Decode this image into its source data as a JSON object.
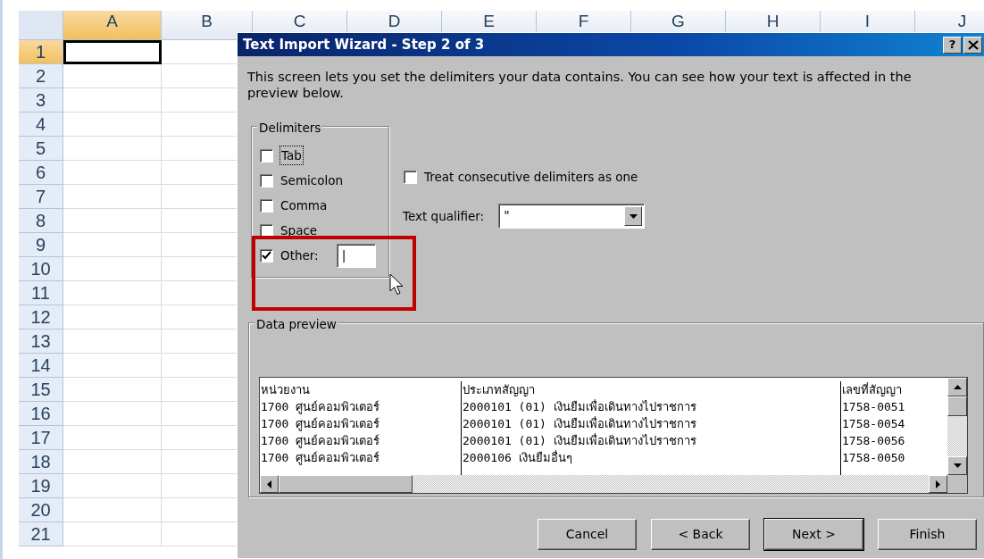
{
  "sheet": {
    "columns": [
      {
        "label": "A",
        "selected": true
      },
      {
        "label": "B",
        "selected": false
      },
      {
        "label": "C",
        "selected": false
      },
      {
        "label": "D",
        "selected": false
      },
      {
        "label": "E",
        "selected": false
      },
      {
        "label": "F",
        "selected": false
      },
      {
        "label": "G",
        "selected": false
      },
      {
        "label": "H",
        "selected": false
      },
      {
        "label": "I",
        "selected": false
      },
      {
        "label": "J",
        "selected": false
      }
    ],
    "rows": [
      {
        "label": "1",
        "selected": true
      },
      {
        "label": "2",
        "selected": false
      },
      {
        "label": "3",
        "selected": false
      },
      {
        "label": "4",
        "selected": false
      },
      {
        "label": "5",
        "selected": false
      },
      {
        "label": "6",
        "selected": false
      },
      {
        "label": "7",
        "selected": false
      },
      {
        "label": "8",
        "selected": false
      },
      {
        "label": "9",
        "selected": false
      },
      {
        "label": "10",
        "selected": false
      },
      {
        "label": "11",
        "selected": false
      },
      {
        "label": "12",
        "selected": false
      },
      {
        "label": "13",
        "selected": false
      },
      {
        "label": "14",
        "selected": false
      },
      {
        "label": "15",
        "selected": false
      },
      {
        "label": "16",
        "selected": false
      },
      {
        "label": "17",
        "selected": false
      },
      {
        "label": "18",
        "selected": false
      },
      {
        "label": "19",
        "selected": false
      },
      {
        "label": "20",
        "selected": false
      },
      {
        "label": "21",
        "selected": false
      }
    ]
  },
  "dialog": {
    "title": "Text Import Wizard - Step 2 of 3",
    "help_button": "?",
    "description": "This screen lets you set the delimiters your data contains.  You can see how your text is affected in the preview below.",
    "delimiters": {
      "legend": "Delimiters",
      "options": [
        {
          "label": "Tab",
          "checked": false,
          "focused": true
        },
        {
          "label": "Semicolon",
          "checked": false,
          "focused": false
        },
        {
          "label": "Comma",
          "checked": false,
          "focused": false
        },
        {
          "label": "Space",
          "checked": false,
          "focused": false
        },
        {
          "label": "Other:",
          "checked": true,
          "focused": false,
          "value": "|"
        }
      ]
    },
    "treat_consecutive": {
      "label": "Treat consecutive delimiters as one",
      "checked": false
    },
    "text_qualifier": {
      "label": "Text qualifier:",
      "value": "\""
    },
    "highlight": true,
    "preview": {
      "legend": "Data preview",
      "rows": [
        [
          "หน่วยงาน",
          "ประเภทสัญญา",
          "เลขที่สัญญา"
        ],
        [
          "1700 ศูนย์คอมพิวเตอร์",
          "2000101  (01)  เงินยืมเพื่อเดินทางไปราชการ",
          "1758-0051"
        ],
        [
          "1700 ศูนย์คอมพิวเตอร์",
          "2000101  (01)  เงินยืมเพื่อเดินทางไปราชการ",
          "1758-0054"
        ],
        [
          "1700 ศูนย์คอมพิวเตอร์",
          "2000101  (01)  เงินยืมเพื่อเดินทางไปราชการ",
          "1758-0056"
        ],
        [
          "1700 ศูนย์คอมพิวเตอร์",
          "2000106 เงินยืมอื่นๆ",
          "1758-0050"
        ]
      ]
    },
    "buttons": [
      {
        "label": "Cancel",
        "default": false
      },
      {
        "label": "< Back",
        "default": false
      },
      {
        "label": "Next >",
        "default": true
      },
      {
        "label": "Finish",
        "default": false
      }
    ]
  }
}
